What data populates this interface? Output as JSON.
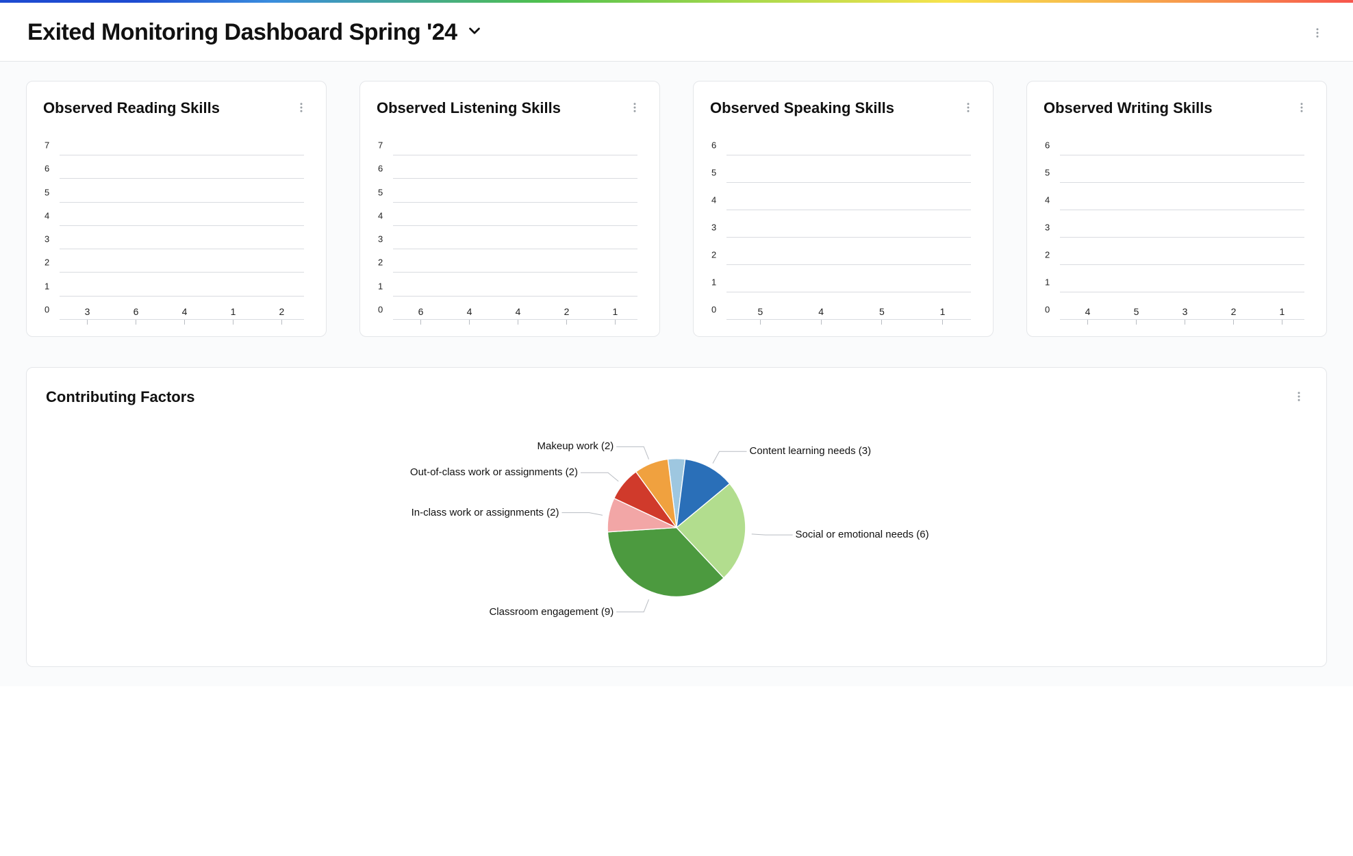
{
  "header": {
    "title": "Exited Monitoring Dashboard Spring '24"
  },
  "cards": [
    {
      "title": "Observed Reading Skills"
    },
    {
      "title": "Observed Listening Skills"
    },
    {
      "title": "Observed Speaking Skills"
    },
    {
      "title": "Observed Writing Skills"
    }
  ],
  "contributing": {
    "title": "Contributing Factors"
  },
  "chart_data": [
    {
      "id": "reading",
      "type": "bar",
      "title": "Observed Reading Skills",
      "categories": [
        "",
        "",
        "",
        "",
        ""
      ],
      "values": [
        3,
        6,
        4,
        1,
        2
      ],
      "ylim": [
        0,
        7
      ],
      "ylabel": "",
      "xlabel": ""
    },
    {
      "id": "listening",
      "type": "bar",
      "title": "Observed Listening Skills",
      "categories": [
        "",
        "",
        "",
        "",
        ""
      ],
      "values": [
        6,
        4,
        4,
        2,
        1
      ],
      "ylim": [
        0,
        7
      ],
      "ylabel": "",
      "xlabel": ""
    },
    {
      "id": "speaking",
      "type": "bar",
      "title": "Observed Speaking Skills",
      "categories": [
        "",
        "",
        "",
        ""
      ],
      "values": [
        5,
        4,
        5,
        1
      ],
      "ylim": [
        0,
        6
      ],
      "ylabel": "",
      "xlabel": ""
    },
    {
      "id": "writing",
      "type": "bar",
      "title": "Observed Writing Skills",
      "categories": [
        "",
        "",
        "",
        "",
        ""
      ],
      "values": [
        4,
        5,
        3,
        2,
        1
      ],
      "ylim": [
        0,
        6
      ],
      "ylabel": "",
      "xlabel": ""
    },
    {
      "id": "contributing",
      "type": "pie",
      "title": "Contributing Factors",
      "series": [
        {
          "name": "Content learning needs",
          "value": 3,
          "color": "#2a6fb8",
          "label": "Content learning needs (3)"
        },
        {
          "name": "Social or emotional needs",
          "value": 6,
          "color": "#b2dd8e",
          "label": "Social or emotional needs (6)"
        },
        {
          "name": "Classroom engagement",
          "value": 9,
          "color": "#4c9a3f",
          "label": "Classroom engagement (9)"
        },
        {
          "name": "In-class work or assignments",
          "value": 2,
          "color": "#f2a6a6",
          "label": "In-class work or assignments (2)"
        },
        {
          "name": "Out-of-class work or assignments",
          "value": 2,
          "color": "#d03a2b",
          "label": "Out-of-class work or assignments (2)"
        },
        {
          "name": "Makeup work",
          "value": 2,
          "color": "#f0a13f",
          "label": "Makeup work (2)"
        }
      ],
      "remainder_color": "#9ec7e0"
    }
  ]
}
